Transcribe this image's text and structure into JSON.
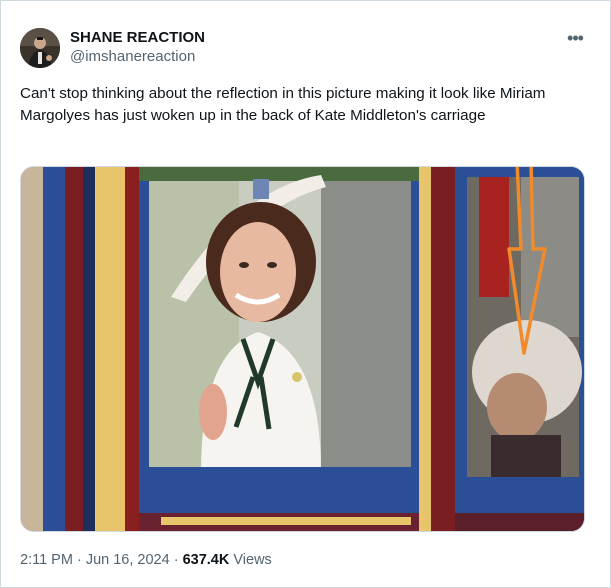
{
  "author": {
    "display_name": "SHANE REACTION",
    "handle": "@imshanereaction",
    "avatar_icon": "profile-photo"
  },
  "more_icon": "more-options-icon",
  "more_glyph": "•••",
  "tweet": {
    "text": "Can't stop thinking about the reflection in this picture making it look like Miriam Margolyes has just woken up in the back of Kate Middleton's carriage"
  },
  "meta": {
    "time": "2:11 PM",
    "date_separator": " · ",
    "date": "Jun 16, 2024",
    "views_separator": " · ",
    "views_count": "637.4K",
    "views_label": " Views"
  },
  "colors": {
    "text_primary": "#0f1419",
    "text_secondary": "#536471",
    "border": "#cfd9de",
    "carriage_blue": "#2b4f97",
    "carriage_red": "#8a1f1f",
    "gold_trim": "#e8c46a",
    "arrow_orange": "#f08a2a"
  }
}
